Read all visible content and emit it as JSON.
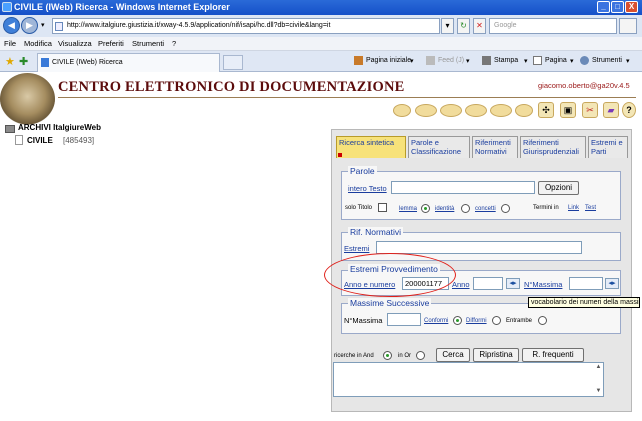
{
  "window": {
    "title": "CIVILE (IWeb) Ricerca - Windows Internet Explorer",
    "buttons": [
      "_",
      "□",
      "X"
    ]
  },
  "address": {
    "url": "http://www.italgiure.giustizia.it/xway-4.5.9/application/nif/isapi/hc.dll?db=civile&lang=it",
    "search_placeholder": "Google"
  },
  "menu": [
    "File",
    "Modifica",
    "Visualizza",
    "Preferiti",
    "Strumenti",
    "?"
  ],
  "tab": {
    "label": "CIVILE (IWeb) Ricerca"
  },
  "toolbar": {
    "home": "Pagina iniziale",
    "feed": "Feed (J)",
    "print": "Stampa",
    "page": "Pagina",
    "tools": "Strumenti"
  },
  "header": {
    "title": "CENTRO ELETTRONICO DI DOCUMENTAZIONE",
    "user": "giacomo.oberto@ga20",
    "version": "v.4.5"
  },
  "tree": {
    "root": "ARCHIVI ItalgiureWeb",
    "child_label": "CIVILE",
    "child_count": "[485493]"
  },
  "tabs": [
    {
      "line1": "Ricerca sintetica",
      "line2": ""
    },
    {
      "line1": "Parole e",
      "line2": "Classificazione"
    },
    {
      "line1": "Riferimenti",
      "line2": "Normativi"
    },
    {
      "line1": "Riferimenti",
      "line2": "Giurisprudenziali"
    },
    {
      "line1": "Estremi e",
      "line2": "Parti"
    }
  ],
  "parole": {
    "legend": "Parole",
    "intero_testo": "intero Testo",
    "opzioni": "Opzioni",
    "solo_titolo": "solo Titolo",
    "lemma": "lemma",
    "identita": "identità",
    "concetti": "concetti",
    "termini_in": "Termini in",
    "link": "Link",
    "test": "Test"
  },
  "rif_normativi": {
    "legend": "Rif. Normativi",
    "estremi": "Estremi"
  },
  "estremi_provv": {
    "legend": "Estremi Provvedimento",
    "anno_numero": "Anno e numero",
    "anno_numero_value": "200001177",
    "anno": "Anno",
    "nmassima": "N°Massima"
  },
  "tooltip": "vocabolario dei numeri della massima",
  "massime": {
    "legend": "Massime Successive",
    "nmassima": "N°Massima",
    "conformi": "Conformi",
    "difformi": "Difformi",
    "entrambe": "Entrambe"
  },
  "bottom": {
    "ricerche_and": "ricerche in And",
    "in_or": "in Or",
    "cerca": "Cerca",
    "ripristina": "Ripristina",
    "frequenti": "R. frequenti"
  }
}
